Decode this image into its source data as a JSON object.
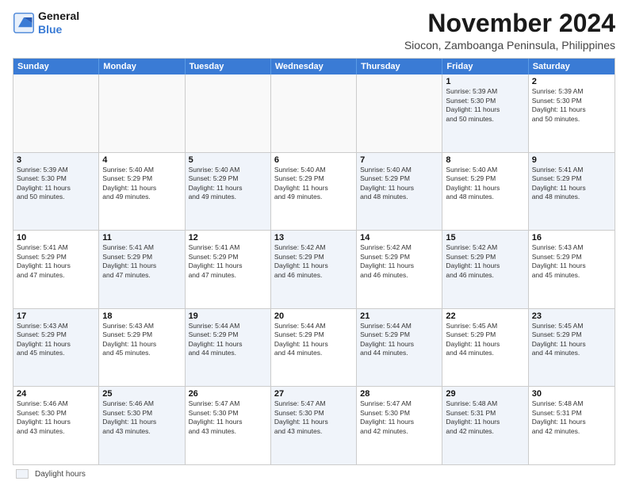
{
  "logo": {
    "line1": "General",
    "line2": "Blue"
  },
  "title": "November 2024",
  "subtitle": "Siocon, Zamboanga Peninsula, Philippines",
  "header_days": [
    "Sunday",
    "Monday",
    "Tuesday",
    "Wednesday",
    "Thursday",
    "Friday",
    "Saturday"
  ],
  "legend_label": "Daylight hours",
  "weeks": [
    [
      {
        "day": "",
        "info": "",
        "empty": true
      },
      {
        "day": "",
        "info": "",
        "empty": true
      },
      {
        "day": "",
        "info": "",
        "empty": true
      },
      {
        "day": "",
        "info": "",
        "empty": true
      },
      {
        "day": "",
        "info": "",
        "empty": true
      },
      {
        "day": "1",
        "info": "Sunrise: 5:39 AM\nSunset: 5:30 PM\nDaylight: 11 hours\nand 50 minutes.",
        "shaded": true
      },
      {
        "day": "2",
        "info": "Sunrise: 5:39 AM\nSunset: 5:30 PM\nDaylight: 11 hours\nand 50 minutes.",
        "shaded": false
      }
    ],
    [
      {
        "day": "3",
        "info": "Sunrise: 5:39 AM\nSunset: 5:30 PM\nDaylight: 11 hours\nand 50 minutes.",
        "shaded": true
      },
      {
        "day": "4",
        "info": "Sunrise: 5:40 AM\nSunset: 5:29 PM\nDaylight: 11 hours\nand 49 minutes.",
        "shaded": false
      },
      {
        "day": "5",
        "info": "Sunrise: 5:40 AM\nSunset: 5:29 PM\nDaylight: 11 hours\nand 49 minutes.",
        "shaded": true
      },
      {
        "day": "6",
        "info": "Sunrise: 5:40 AM\nSunset: 5:29 PM\nDaylight: 11 hours\nand 49 minutes.",
        "shaded": false
      },
      {
        "day": "7",
        "info": "Sunrise: 5:40 AM\nSunset: 5:29 PM\nDaylight: 11 hours\nand 48 minutes.",
        "shaded": true
      },
      {
        "day": "8",
        "info": "Sunrise: 5:40 AM\nSunset: 5:29 PM\nDaylight: 11 hours\nand 48 minutes.",
        "shaded": false
      },
      {
        "day": "9",
        "info": "Sunrise: 5:41 AM\nSunset: 5:29 PM\nDaylight: 11 hours\nand 48 minutes.",
        "shaded": true
      }
    ],
    [
      {
        "day": "10",
        "info": "Sunrise: 5:41 AM\nSunset: 5:29 PM\nDaylight: 11 hours\nand 47 minutes.",
        "shaded": false
      },
      {
        "day": "11",
        "info": "Sunrise: 5:41 AM\nSunset: 5:29 PM\nDaylight: 11 hours\nand 47 minutes.",
        "shaded": true
      },
      {
        "day": "12",
        "info": "Sunrise: 5:41 AM\nSunset: 5:29 PM\nDaylight: 11 hours\nand 47 minutes.",
        "shaded": false
      },
      {
        "day": "13",
        "info": "Sunrise: 5:42 AM\nSunset: 5:29 PM\nDaylight: 11 hours\nand 46 minutes.",
        "shaded": true
      },
      {
        "day": "14",
        "info": "Sunrise: 5:42 AM\nSunset: 5:29 PM\nDaylight: 11 hours\nand 46 minutes.",
        "shaded": false
      },
      {
        "day": "15",
        "info": "Sunrise: 5:42 AM\nSunset: 5:29 PM\nDaylight: 11 hours\nand 46 minutes.",
        "shaded": true
      },
      {
        "day": "16",
        "info": "Sunrise: 5:43 AM\nSunset: 5:29 PM\nDaylight: 11 hours\nand 45 minutes.",
        "shaded": false
      }
    ],
    [
      {
        "day": "17",
        "info": "Sunrise: 5:43 AM\nSunset: 5:29 PM\nDaylight: 11 hours\nand 45 minutes.",
        "shaded": true
      },
      {
        "day": "18",
        "info": "Sunrise: 5:43 AM\nSunset: 5:29 PM\nDaylight: 11 hours\nand 45 minutes.",
        "shaded": false
      },
      {
        "day": "19",
        "info": "Sunrise: 5:44 AM\nSunset: 5:29 PM\nDaylight: 11 hours\nand 44 minutes.",
        "shaded": true
      },
      {
        "day": "20",
        "info": "Sunrise: 5:44 AM\nSunset: 5:29 PM\nDaylight: 11 hours\nand 44 minutes.",
        "shaded": false
      },
      {
        "day": "21",
        "info": "Sunrise: 5:44 AM\nSunset: 5:29 PM\nDaylight: 11 hours\nand 44 minutes.",
        "shaded": true
      },
      {
        "day": "22",
        "info": "Sunrise: 5:45 AM\nSunset: 5:29 PM\nDaylight: 11 hours\nand 44 minutes.",
        "shaded": false
      },
      {
        "day": "23",
        "info": "Sunrise: 5:45 AM\nSunset: 5:29 PM\nDaylight: 11 hours\nand 44 minutes.",
        "shaded": true
      }
    ],
    [
      {
        "day": "24",
        "info": "Sunrise: 5:46 AM\nSunset: 5:30 PM\nDaylight: 11 hours\nand 43 minutes.",
        "shaded": false
      },
      {
        "day": "25",
        "info": "Sunrise: 5:46 AM\nSunset: 5:30 PM\nDaylight: 11 hours\nand 43 minutes.",
        "shaded": true
      },
      {
        "day": "26",
        "info": "Sunrise: 5:47 AM\nSunset: 5:30 PM\nDaylight: 11 hours\nand 43 minutes.",
        "shaded": false
      },
      {
        "day": "27",
        "info": "Sunrise: 5:47 AM\nSunset: 5:30 PM\nDaylight: 11 hours\nand 43 minutes.",
        "shaded": true
      },
      {
        "day": "28",
        "info": "Sunrise: 5:47 AM\nSunset: 5:30 PM\nDaylight: 11 hours\nand 42 minutes.",
        "shaded": false
      },
      {
        "day": "29",
        "info": "Sunrise: 5:48 AM\nSunset: 5:31 PM\nDaylight: 11 hours\nand 42 minutes.",
        "shaded": true
      },
      {
        "day": "30",
        "info": "Sunrise: 5:48 AM\nSunset: 5:31 PM\nDaylight: 11 hours\nand 42 minutes.",
        "shaded": false
      }
    ]
  ]
}
